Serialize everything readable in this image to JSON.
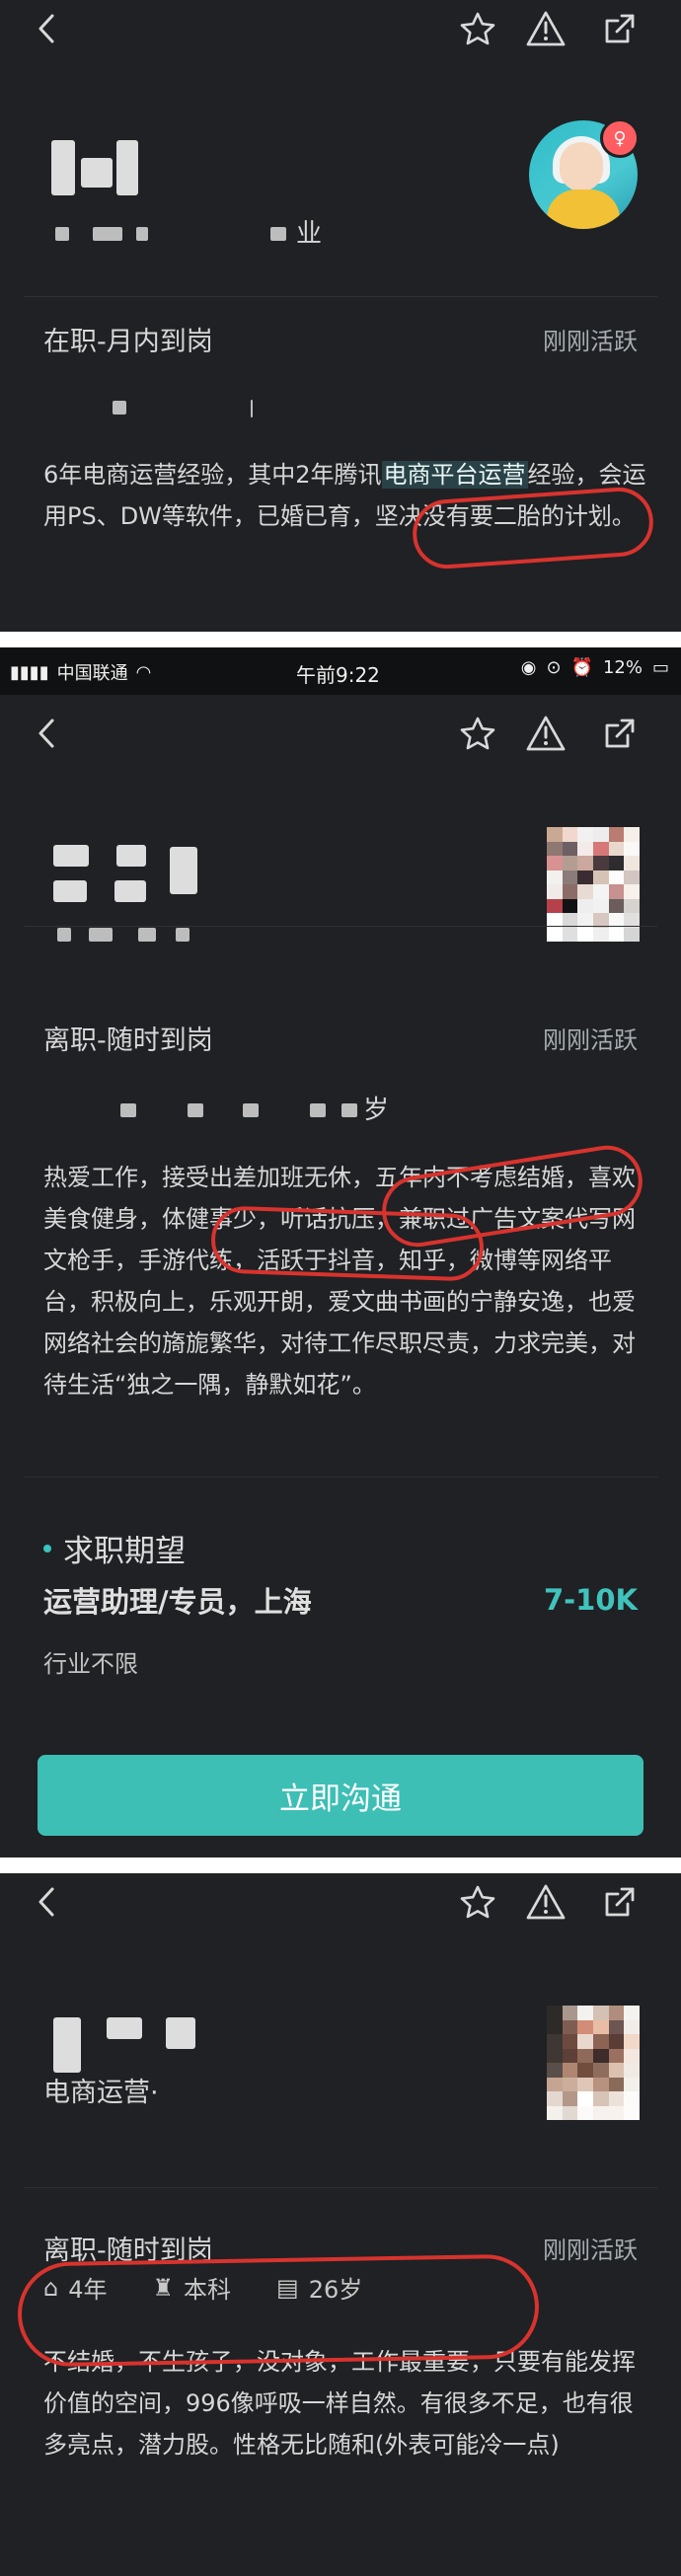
{
  "panel1": {
    "status": "刚刚活跃",
    "title": "在职-月内到岗",
    "description_parts": {
      "p1": "6年电商运营经验，其中2年腾讯",
      "h1": "电商平台运营",
      "p2": "经验，会运用PS、DW等软件，已婚已育，",
      "h2": "坚决没有要二胎",
      "p3": "的计划。"
    },
    "blurred_suffix": "业"
  },
  "panel2": {
    "statusbar": {
      "carrier": "中国联通",
      "time": "午前9:22",
      "battery": "12%"
    },
    "title": "离职-随时到岗",
    "status": "刚刚活跃",
    "description": "热爱工作，接受出差加班无休，五年内不考虑结婚，喜欢美食健身，体健事少，听话抗压，兼职过广告文案代写网文枪手，手游代练，活跃于抖音，知乎，微博等网络平台，积极向上，乐观开朗，爱文曲书画的宁静安逸，也爱网络社会的旖旎繁华，对待工作尽职尽责，力求完美，对待生活“独之一隅，静默如花”。",
    "expectation": {
      "title": "求职期望",
      "job": "运营助理/专员，上海",
      "salary": "7-10K",
      "industry": "行业不限"
    },
    "button": "立即沟通",
    "blurred_suffix": "岁"
  },
  "panel3": {
    "role": "电商运营·",
    "title": "离职-随时到岗",
    "status": "刚刚活跃",
    "meta": {
      "experience": "4年",
      "education": "本科",
      "age": "26岁"
    },
    "description": "不结婚，不生孩子，没对象，工作最重要，只要有能发挥价值的空间，996像呼吸一样自然。有很多不足，也有很多亮点，潜力股。性格无比随和(外表可能冷一点)"
  },
  "icons": {
    "back": "chevron-left-icon",
    "favorite": "star-icon",
    "report": "warning-icon",
    "share": "share-icon",
    "wifi": "wifi-icon",
    "alarm": "alarm-icon",
    "battery": "battery-icon",
    "location": "location-icon",
    "lock": "lock-icon",
    "graduation": "graduation-icon",
    "calendar": "calendar-icon",
    "briefcase": "briefcase-icon"
  },
  "colors": {
    "background": "#1f2124",
    "accent": "#3dbfb5",
    "red_annotation": "#d8332e",
    "highlight": "#284247"
  }
}
